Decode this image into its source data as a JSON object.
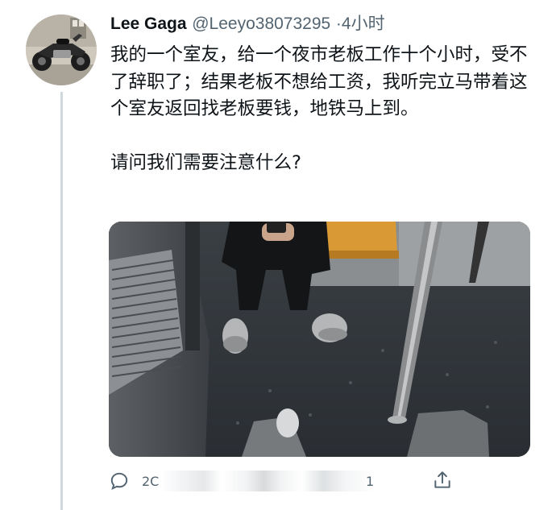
{
  "tweet": {
    "display_name": "Lee Gaga",
    "handle": "@Leeyo38073295",
    "time_separator": "·",
    "time_ago": "4小时",
    "body_lines": [
      "我的一个室友，给一个夜市老板工作十个小时，受不了辞职了；结果老板不想给工资，我听完立马带着这个室友返回找老板要钱，地铁马上到。",
      "请问我们需要注意什么?"
    ],
    "avatar_icon": "motorcycle-avatar",
    "media_icon": "subway-car-photo"
  },
  "actions": {
    "reply_count": "2C",
    "like_count_partial": "1",
    "icons": [
      "reply-icon",
      "retweet-icon",
      "like-icon",
      "share-icon"
    ]
  },
  "colors": {
    "text_primary": "#0f1419",
    "text_secondary": "#536471",
    "thread_line": "#cfd9de",
    "background": "#ffffff"
  }
}
